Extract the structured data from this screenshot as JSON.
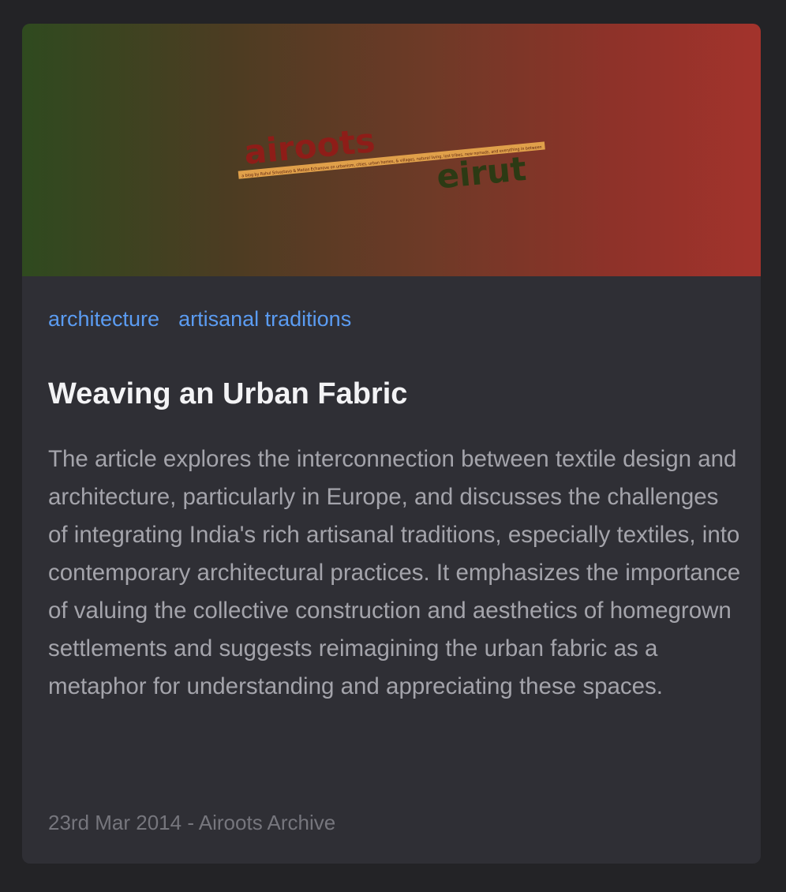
{
  "banner": {
    "logo_word_1": "airoots",
    "logo_word_2": "eirut",
    "logo_tagline": "a blog by Rahul Srivastava & Matias Echanove on urbanism, cities, urban homes, & villages, natural living, lost tribes, new nomads, and everything in between",
    "gradient_start": "#2f4a1f",
    "gradient_end": "#a3332c"
  },
  "tags": [
    {
      "label": "architecture"
    },
    {
      "label": "artisanal traditions"
    }
  ],
  "article": {
    "title": "Weaving an Urban Fabric",
    "summary": "The article explores the interconnection between textile design and architecture, particularly in Europe, and discusses the challenges of integrating India's rich artisanal traditions, especially textiles, into contemporary architectural practices. It emphasizes the importance of valuing the collective construction and aesthetics of homegrown settlements and suggests reimagining the urban fabric as a metaphor for understanding and appreciating these spaces.",
    "meta": "23rd Mar 2014 - Airoots Archive"
  },
  "colors": {
    "page_background": "#232326",
    "card_background": "#2f2f35",
    "tag_link": "#5b9cf2",
    "title_text": "#f3f3f5",
    "summary_text": "#a4a4ab",
    "meta_text": "#76767d"
  }
}
